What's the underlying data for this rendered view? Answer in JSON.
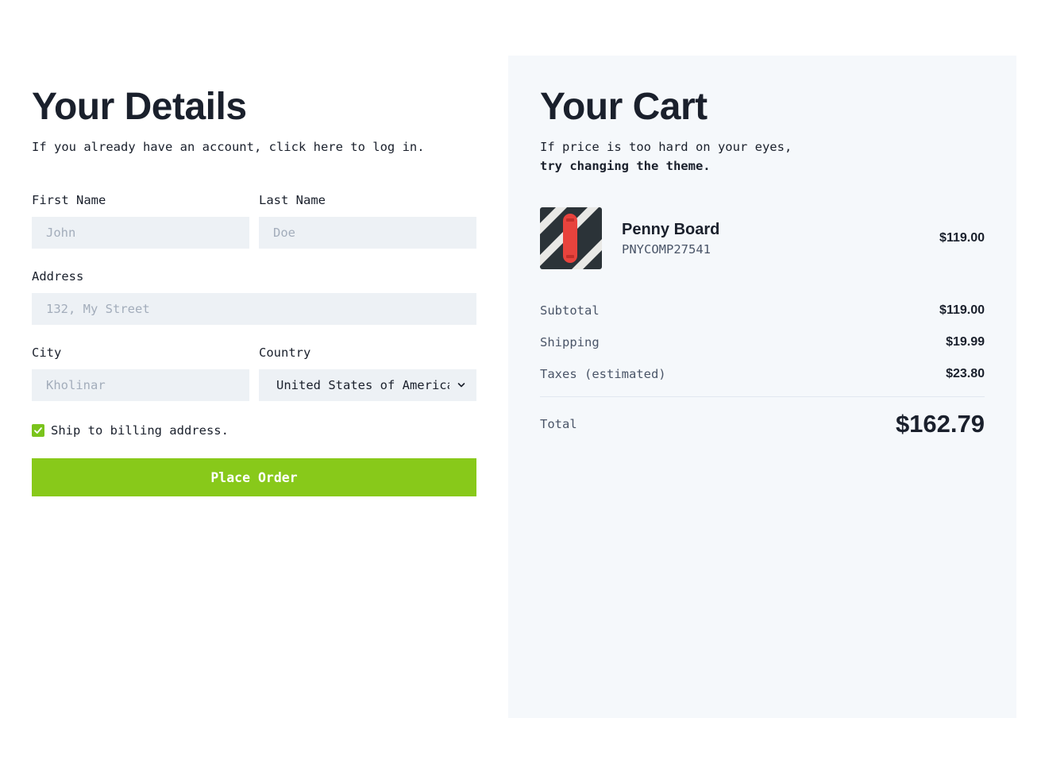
{
  "details": {
    "title": "Your Details",
    "subtitle": "If you already have an account, click here to log in.",
    "first_name": {
      "label": "First Name",
      "placeholder": "John",
      "value": ""
    },
    "last_name": {
      "label": "Last Name",
      "placeholder": "Doe",
      "value": ""
    },
    "address": {
      "label": "Address",
      "placeholder": "132, My Street",
      "value": ""
    },
    "city": {
      "label": "City",
      "placeholder": "Kholinar",
      "value": ""
    },
    "country": {
      "label": "Country",
      "value": "United States of America"
    },
    "ship_checkbox": {
      "label": "Ship to billing address.",
      "checked": true
    },
    "place_order_label": "Place Order"
  },
  "cart": {
    "title": "Your Cart",
    "subtitle_line1": "If price is too hard on your eyes,",
    "subtitle_line2": "try changing the theme.",
    "items": [
      {
        "name": "Penny Board",
        "sku": "PNYCOMP27541",
        "price": "$119.00",
        "image_icon": "skateboard-image"
      }
    ],
    "summary": {
      "subtotal_label": "Subtotal",
      "subtotal": "$119.00",
      "shipping_label": "Shipping",
      "shipping": "$19.99",
      "taxes_label": "Taxes (estimated)",
      "taxes": "$23.80",
      "total_label": "Total",
      "total": "$162.79"
    }
  },
  "colors": {
    "accent": "#88c91a",
    "input_bg": "#edf1f5",
    "cart_bg": "#f5f8fb",
    "text": "#1a202c"
  }
}
